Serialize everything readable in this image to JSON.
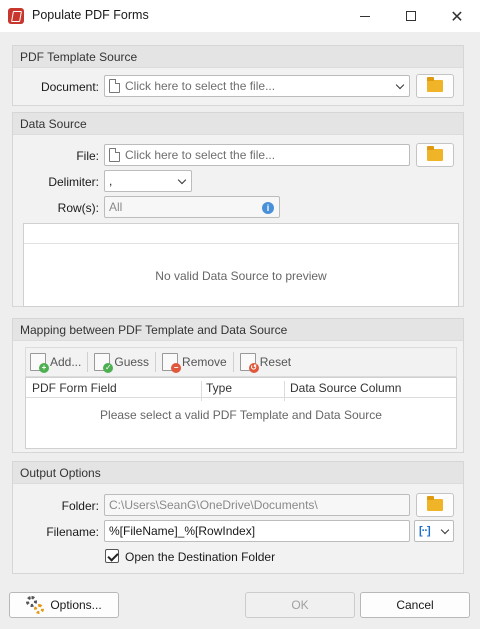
{
  "window": {
    "title": "Populate PDF Forms"
  },
  "template_source": {
    "header": "PDF Template Source",
    "document_label": "Document:",
    "document_placeholder": "Click here to select the file..."
  },
  "data_source": {
    "header": "Data Source",
    "file_label": "File:",
    "file_placeholder": "Click here to select the file...",
    "delimiter_label": "Delimiter:",
    "delimiter_value": ",",
    "rows_label": "Row(s):",
    "rows_value": "All",
    "preview_message": "No valid Data Source to preview"
  },
  "mapping": {
    "header": "Mapping between PDF Template and Data Source",
    "toolbar": {
      "add": "Add...",
      "guess": "Guess",
      "remove": "Remove",
      "reset": "Reset"
    },
    "columns": [
      "PDF Form Field",
      "Type",
      "Data Source Column"
    ],
    "empty_message": "Please select a valid PDF Template and Data Source"
  },
  "output": {
    "header": "Output Options",
    "folder_label": "Folder:",
    "folder_value": "C:\\Users\\SeanG\\OneDrive\\Documents\\",
    "filename_label": "Filename:",
    "filename_value": "%[FileName]_%[RowIndex]",
    "open_folder_label": "Open the Destination Folder",
    "open_folder_checked": true
  },
  "footer": {
    "options": "Options...",
    "ok": "OK",
    "cancel": "Cancel"
  },
  "colors": {
    "accent_blue": "#1a6fc9",
    "folder_yellow": "#f0b429",
    "app_red": "#c8372d"
  }
}
